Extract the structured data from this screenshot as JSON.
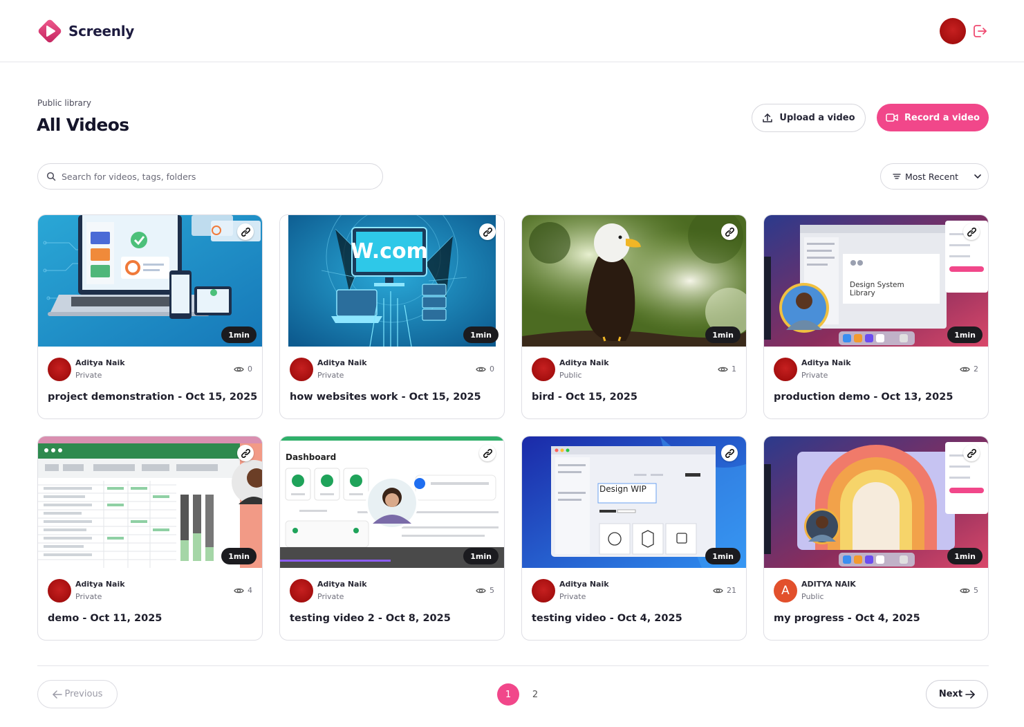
{
  "app": {
    "name": "Screenly"
  },
  "header": {
    "avatar_label": "Aditya Naik",
    "logout_label": "Log out"
  },
  "page": {
    "breadcrumb": "Public library",
    "title": "All Videos",
    "upload_label": "Upload a video",
    "record_label": "Record a video"
  },
  "search": {
    "placeholder": "Search for videos, tags, folders",
    "value": ""
  },
  "sort": {
    "label": "Most Recent"
  },
  "colors": {
    "accent": "#f1478a",
    "avatar_red": "#b31414",
    "text_dark": "#1f1f2c"
  },
  "videos": [
    {
      "title": "project demonstration - Oct 15, 2025",
      "author": "Aditya Naik",
      "visibility": "Private",
      "views": "0",
      "duration": "1min",
      "thumbnail": "web-devices-illustration"
    },
    {
      "title": "how websites work - Oct 15, 2025",
      "author": "Aditya Naik",
      "visibility": "Private",
      "views": "0",
      "duration": "1min",
      "thumbnail": "w-com-network-illustration",
      "thumb_text": "W.com"
    },
    {
      "title": "bird - Oct 15, 2025",
      "author": "Aditya Naik",
      "visibility": "Public",
      "views": "1",
      "duration": "1min",
      "thumbnail": "bald-eagle-photo"
    },
    {
      "title": "production demo - Oct 13, 2025",
      "author": "Aditya Naik",
      "visibility": "Private",
      "views": "2",
      "duration": "1min",
      "thumbnail": "design-system-screen-recording",
      "thumb_text": "Design System Library"
    },
    {
      "title": "demo - Oct 11, 2025",
      "author": "Aditya Naik",
      "visibility": "Private",
      "views": "4",
      "duration": "1min",
      "thumbnail": "spreadsheet-screen-recording"
    },
    {
      "title": "testing video 2 - Oct 8, 2025",
      "author": "Aditya Naik",
      "visibility": "Private",
      "views": "5",
      "duration": "1min",
      "thumbnail": "dashboard-screen-recording",
      "thumb_text": "Dashboard"
    },
    {
      "title": "testing video - Oct 4, 2025",
      "author": "Aditya Naik",
      "visibility": "Private",
      "views": "21",
      "duration": "1min",
      "thumbnail": "design-wip-screen-recording",
      "thumb_text": "Design WIP"
    },
    {
      "title": "my progress - Oct 4, 2025",
      "author": "ADITYA NAIK",
      "visibility": "Public",
      "views": "5",
      "duration": "1min",
      "thumbnail": "rainbow-screen-recording",
      "avatar_letter": "A"
    }
  ],
  "pagination": {
    "previous_label": "Previous",
    "next_label": "Next",
    "pages": [
      "1",
      "2"
    ],
    "current": "1"
  }
}
